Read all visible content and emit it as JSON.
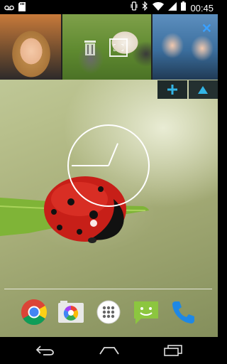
{
  "status_bar": {
    "time": "00:45",
    "left_icons": [
      "voicemail-icon",
      "sd-card-icon"
    ],
    "right_icons": [
      "vibrate-icon",
      "bluetooth-icon",
      "wifi-icon",
      "signal-icon",
      "battery-icon"
    ]
  },
  "photo_widget": {
    "photos": [
      "photo-woman",
      "photo-puppies",
      "photo-kids"
    ],
    "overlay_icons": [
      "delete-icon",
      "fullscreen-icon",
      "close-icon"
    ],
    "close_label": "✕"
  },
  "controls": {
    "add_label": "+",
    "up_label": "▲"
  },
  "clock": {
    "hour": 0,
    "minute": 45
  },
  "dock": {
    "apps": [
      "chrome",
      "gallery",
      "app-drawer",
      "messaging",
      "phone"
    ]
  },
  "colors": {
    "accent": "#33b5e5",
    "ladybug_red": "#d8261e",
    "leaf_green": "#7fb437"
  }
}
